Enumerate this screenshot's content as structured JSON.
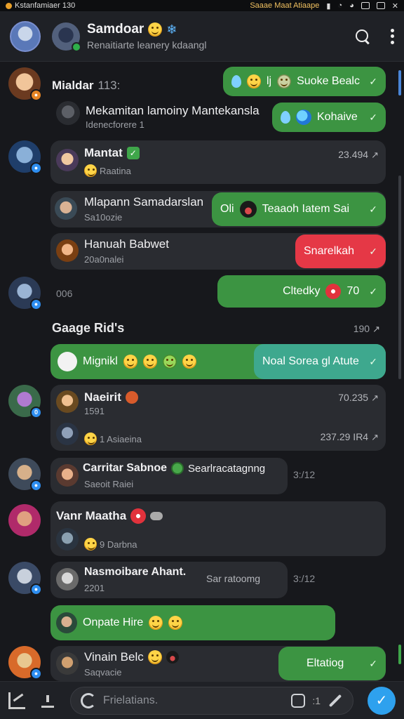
{
  "status_bar": {
    "left_text": "Kstanfamiaer 130",
    "center_text": "Saaae Maat Atiaape"
  },
  "header": {
    "title": "Samdoar",
    "subtitle": "Renaitiarte leanery kdaangl"
  },
  "feed": {
    "row1": {
      "name": "Mialdar",
      "count": "113:",
      "pill": "Suoke Bealc"
    },
    "row2": {
      "name": "Mekamitan lamoiny Mantekansla",
      "sub": "Idenecforere 1",
      "pill": "Kohaive"
    },
    "row3": {
      "name": "Mantat",
      "sub": "Raatina",
      "time": "23.494"
    },
    "row4": {
      "name": "Mlapann Samadarslan",
      "sub": "Sa10ozie",
      "pill_prefix": "Oli",
      "pill": "Teaaoh Iatem Sai"
    },
    "row5": {
      "name": "Hanuah Babwet",
      "sub": "20a0nalei",
      "pill": "Snarelkah"
    },
    "row6": {
      "number": "006",
      "pill": "Cltedky",
      "pill_count": "70"
    },
    "section": {
      "title": "Gaage Rid's",
      "meta": "190"
    },
    "row7": {
      "name": "Mignikl",
      "pill": "Noal Sorea gl Atute"
    },
    "row8": {
      "name": "Naeirit",
      "sub": "1591",
      "time": "70.235",
      "sub2": "1 Asiaeina",
      "time2": "237.29 IR4"
    },
    "row9": {
      "name": "Carritar Sabnoe",
      "extra": "Searlracatagnng",
      "sub": "Saeoit Raiei",
      "time": "3:/12"
    },
    "row10": {
      "name": "Vanr Maatha",
      "sub": "9 Darbna"
    },
    "row11": {
      "name": "Nasmoibare Ahant.",
      "sub": "2201",
      "extra": "Sar ratoomg",
      "time": "3:/12"
    },
    "row12": {
      "name": "Onpate Hire"
    },
    "row13": {
      "name": "Vinain Belc",
      "sub": "Saqvacie",
      "pill": "Eltatiog"
    }
  },
  "composer": {
    "placeholder": "Frielatians.",
    "count": ":1"
  },
  "colors": {
    "bubble_green": "#3c9442",
    "bubble_red": "#e53846",
    "bubble_teal": "#3ea88e",
    "accent_blue": "#2ea1ee"
  }
}
